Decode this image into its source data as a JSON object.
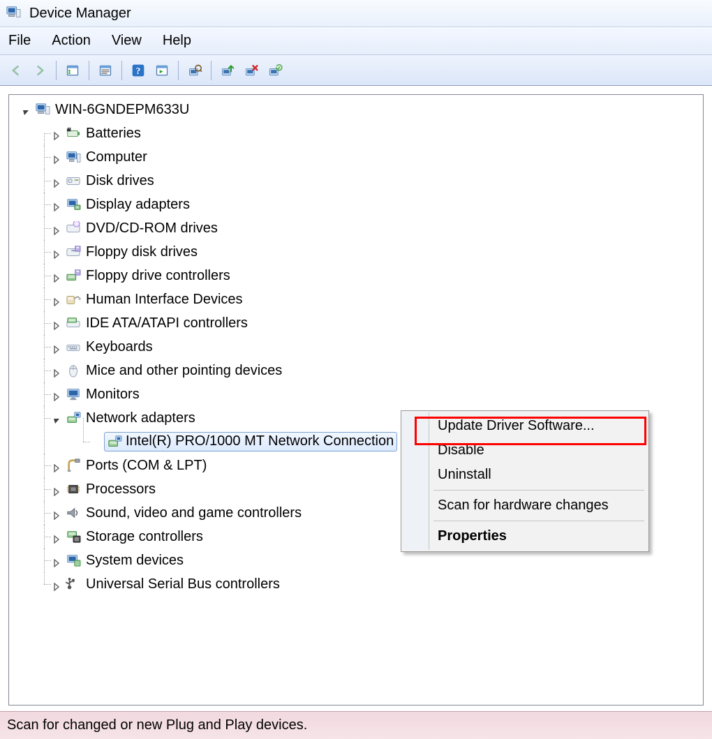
{
  "window": {
    "title": "Device Manager"
  },
  "menubar": {
    "file": "File",
    "action": "Action",
    "view": "View",
    "help": "Help"
  },
  "toolbar_names": {
    "back": "back-icon",
    "forward": "forward-icon",
    "show_hide": "show-hide-tree-icon",
    "properties": "properties-icon",
    "help": "help-icon",
    "refresh": "refresh-icon",
    "scan": "scan-hardware-icon",
    "update": "update-driver-icon",
    "disable": "disable-device-icon",
    "uninstall": "uninstall-device-icon"
  },
  "tree": {
    "root": {
      "label": "WIN-6GNDEPM633U"
    },
    "items": [
      {
        "label": "Batteries",
        "icon": "battery-icon"
      },
      {
        "label": "Computer",
        "icon": "computer-icon"
      },
      {
        "label": "Disk drives",
        "icon": "disk-drive-icon"
      },
      {
        "label": "Display adapters",
        "icon": "display-adapter-icon"
      },
      {
        "label": "DVD/CD-ROM drives",
        "icon": "optical-drive-icon"
      },
      {
        "label": "Floppy disk drives",
        "icon": "floppy-drive-icon"
      },
      {
        "label": "Floppy drive controllers",
        "icon": "floppy-controller-icon"
      },
      {
        "label": "Human Interface Devices",
        "icon": "hid-icon"
      },
      {
        "label": "IDE ATA/ATAPI controllers",
        "icon": "ide-controller-icon"
      },
      {
        "label": "Keyboards",
        "icon": "keyboard-icon"
      },
      {
        "label": "Mice and other pointing devices",
        "icon": "mouse-icon"
      },
      {
        "label": "Monitors",
        "icon": "monitor-icon"
      },
      {
        "label": "Network adapters",
        "icon": "network-adapter-icon",
        "expanded": true,
        "children": [
          {
            "label": "Intel(R) PRO/1000 MT Network Connection",
            "icon": "network-adapter-icon",
            "selected": true
          }
        ]
      },
      {
        "label": "Ports (COM & LPT)",
        "icon": "ports-icon"
      },
      {
        "label": "Processors",
        "icon": "processor-icon"
      },
      {
        "label": "Sound, video and game controllers",
        "icon": "sound-icon"
      },
      {
        "label": "Storage controllers",
        "icon": "storage-controller-icon"
      },
      {
        "label": "System devices",
        "icon": "system-device-icon"
      },
      {
        "label": "Universal Serial Bus controllers",
        "icon": "usb-icon"
      }
    ]
  },
  "context_menu": {
    "update": "Update Driver Software...",
    "disable": "Disable",
    "uninstall": "Uninstall",
    "scan": "Scan for hardware changes",
    "props": "Properties"
  },
  "status": "Scan for changed or new Plug and Play devices."
}
